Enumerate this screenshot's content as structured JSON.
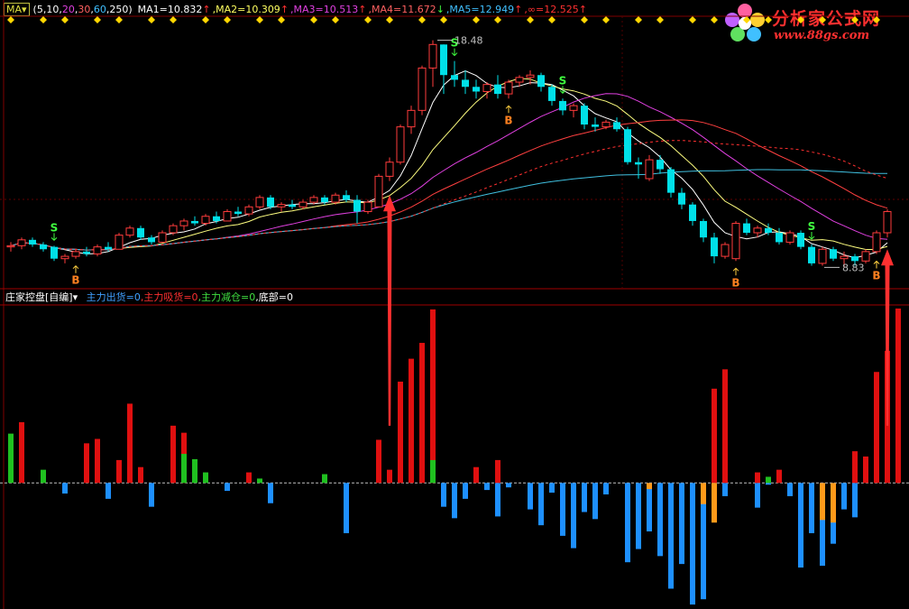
{
  "main_header": {
    "indicator_button": "MA",
    "params_open": "(",
    "params": [
      {
        "text": "5",
        "color": "#ffffff"
      },
      {
        "text": "10",
        "color": "#ffffff"
      },
      {
        "text": "20",
        "color": "#e040e0"
      },
      {
        "text": "30",
        "color": "#ff6060"
      },
      {
        "text": "60",
        "color": "#40c0ff"
      },
      {
        "text": "250",
        "color": "#ffffff"
      }
    ],
    "params_close": ")",
    "ma_values": [
      {
        "text": "MA1=10.832",
        "arrow": "↑",
        "color": "#ffffff",
        "arrow_color": "#ff3030"
      },
      {
        "text": "MA2=10.309",
        "arrow": "↑",
        "color": "#ffff60",
        "arrow_color": "#ff3030"
      },
      {
        "text": "MA3=10.513",
        "arrow": "↑",
        "color": "#e040e0",
        "arrow_color": "#ff3030"
      },
      {
        "text": "MA4=11.672",
        "arrow": "↓",
        "color": "#ff6060",
        "arrow_color": "#40ff40"
      },
      {
        "text": "MA5=12.949",
        "arrow": "↑",
        "color": "#40c0ff",
        "arrow_color": "#ff3030"
      },
      {
        "text": "∞=12.525",
        "arrow": "↑",
        "color": "#ff3030",
        "arrow_color": "#ff3030"
      }
    ]
  },
  "sub_header": {
    "title": "庄家控盘[自编]",
    "items": [
      {
        "text": "主力出货=0",
        "color": "#40a0ff"
      },
      {
        "text": "主力吸货=0",
        "color": "#ff3030"
      },
      {
        "text": "主力减仓=0",
        "color": "#40e040"
      },
      {
        "text": "底部=0",
        "color": "#ffffff"
      }
    ]
  },
  "logo": {
    "line1": "分析家公式网",
    "line2": "www.88gs.com"
  },
  "chart_data": [
    {
      "type": "candlestick",
      "title": "MA",
      "ylim": [
        8,
        19.5
      ],
      "annotations": {
        "high_label": "18.48",
        "low_label": "8.83"
      },
      "signals": [
        {
          "index": 4,
          "label": "S"
        },
        {
          "index": 6,
          "label": "B"
        },
        {
          "index": 41,
          "label": "S"
        },
        {
          "index": 46,
          "label": "B"
        },
        {
          "index": 51,
          "label": "S"
        },
        {
          "index": 67,
          "label": "B"
        },
        {
          "index": 74,
          "label": "S"
        },
        {
          "index": 80,
          "label": "B"
        }
      ],
      "candles": [
        [
          9.7,
          9.9,
          9.5,
          9.75
        ],
        [
          9.75,
          10.1,
          9.6,
          10.0
        ],
        [
          10.0,
          10.1,
          9.7,
          9.8
        ],
        [
          9.8,
          9.9,
          9.5,
          9.6
        ],
        [
          9.7,
          9.75,
          9.1,
          9.2
        ],
        [
          9.2,
          9.4,
          9.0,
          9.3
        ],
        [
          9.3,
          9.6,
          9.2,
          9.5
        ],
        [
          9.5,
          9.7,
          9.3,
          9.4
        ],
        [
          9.4,
          9.8,
          9.3,
          9.7
        ],
        [
          9.7,
          9.9,
          9.5,
          9.6
        ],
        [
          9.6,
          10.3,
          9.6,
          10.2
        ],
        [
          10.2,
          10.6,
          10.1,
          10.5
        ],
        [
          10.5,
          10.6,
          10.0,
          10.1
        ],
        [
          10.1,
          10.2,
          9.8,
          9.9
        ],
        [
          9.9,
          10.4,
          9.9,
          10.3
        ],
        [
          10.3,
          10.7,
          10.2,
          10.6
        ],
        [
          10.6,
          10.9,
          10.4,
          10.8
        ],
        [
          10.8,
          11.0,
          10.6,
          10.7
        ],
        [
          10.7,
          11.1,
          10.6,
          11.0
        ],
        [
          11.0,
          11.2,
          10.7,
          10.8
        ],
        [
          10.8,
          11.3,
          10.8,
          11.2
        ],
        [
          11.2,
          11.4,
          11.0,
          11.1
        ],
        [
          11.1,
          11.5,
          11.0,
          11.4
        ],
        [
          11.4,
          11.9,
          11.3,
          11.8
        ],
        [
          11.8,
          11.9,
          11.3,
          11.4
        ],
        [
          11.4,
          11.6,
          11.2,
          11.5
        ],
        [
          11.5,
          11.7,
          11.3,
          11.4
        ],
        [
          11.4,
          11.7,
          11.3,
          11.6
        ],
        [
          11.6,
          11.9,
          11.5,
          11.8
        ],
        [
          11.8,
          11.9,
          11.5,
          11.6
        ],
        [
          11.6,
          12.0,
          11.5,
          11.9
        ],
        [
          11.9,
          12.1,
          11.6,
          11.7
        ],
        [
          11.7,
          11.9,
          10.7,
          11.2
        ],
        [
          11.2,
          11.7,
          11.1,
          11.6
        ],
        [
          11.4,
          12.8,
          11.4,
          12.7
        ],
        [
          12.7,
          13.5,
          12.5,
          13.3
        ],
        [
          13.3,
          14.9,
          13.2,
          14.8
        ],
        [
          14.8,
          15.7,
          14.5,
          15.5
        ],
        [
          15.5,
          17.4,
          15.3,
          17.3
        ],
        [
          17.3,
          18.48,
          16.5,
          18.3
        ],
        [
          18.3,
          18.3,
          16.2,
          17.0
        ],
        [
          17.0,
          17.6,
          16.5,
          16.8
        ],
        [
          16.8,
          17.2,
          16.2,
          16.5
        ],
        [
          16.5,
          16.8,
          16.0,
          16.3
        ],
        [
          16.3,
          16.7,
          16.0,
          16.6
        ],
        [
          16.6,
          17.0,
          16.0,
          16.2
        ],
        [
          16.2,
          16.8,
          16.0,
          16.7
        ],
        [
          16.7,
          17.0,
          16.5,
          16.9
        ],
        [
          16.9,
          17.2,
          16.6,
          17.0
        ],
        [
          17.0,
          17.1,
          16.3,
          16.5
        ],
        [
          16.5,
          16.6,
          15.7,
          15.9
        ],
        [
          15.9,
          16.0,
          15.3,
          15.5
        ],
        [
          15.5,
          15.8,
          15.2,
          15.7
        ],
        [
          15.7,
          15.8,
          14.7,
          14.9
        ],
        [
          14.9,
          15.2,
          14.6,
          14.8
        ],
        [
          14.8,
          15.1,
          14.7,
          15.0
        ],
        [
          15.0,
          15.2,
          14.6,
          14.7
        ],
        [
          14.7,
          14.8,
          13.2,
          13.3
        ],
        [
          13.3,
          13.5,
          12.6,
          13.2
        ],
        [
          12.6,
          13.6,
          12.5,
          13.4
        ],
        [
          13.4,
          13.6,
          12.8,
          13.0
        ],
        [
          13.0,
          13.1,
          11.8,
          12.0
        ],
        [
          12.0,
          12.2,
          11.3,
          11.5
        ],
        [
          11.5,
          11.6,
          10.6,
          10.8
        ],
        [
          10.8,
          10.9,
          9.9,
          10.1
        ],
        [
          10.1,
          10.3,
          9.0,
          9.3
        ],
        [
          9.3,
          9.9,
          9.2,
          9.8
        ],
        [
          9.2,
          10.8,
          9.1,
          10.7
        ],
        [
          10.7,
          10.9,
          10.2,
          10.3
        ],
        [
          10.3,
          10.6,
          10.1,
          10.5
        ],
        [
          10.5,
          10.7,
          10.2,
          10.3
        ],
        [
          10.3,
          10.5,
          9.8,
          9.9
        ],
        [
          9.9,
          10.4,
          9.8,
          10.3
        ],
        [
          10.3,
          10.4,
          9.6,
          9.7
        ],
        [
          9.7,
          9.8,
          8.9,
          9.0
        ],
        [
          9.0,
          9.7,
          8.9,
          9.6
        ],
        [
          9.6,
          9.7,
          9.1,
          9.2
        ],
        [
          9.2,
          9.5,
          8.83,
          9.3
        ],
        [
          9.3,
          9.4,
          8.9,
          9.1
        ],
        [
          9.1,
          9.6,
          9.0,
          9.5
        ],
        [
          9.5,
          10.4,
          9.4,
          10.3
        ],
        [
          10.3,
          11.3,
          10.1,
          11.2
        ]
      ]
    },
    {
      "type": "bar",
      "title": "庄家控盘[自编]",
      "ylim": [
        -14,
        20
      ],
      "series": [
        {
          "name": "主力出货",
          "values": [
            0,
            0,
            0,
            0,
            0,
            -1.2,
            0,
            0,
            0,
            -1.8,
            0,
            0,
            0,
            -2.7,
            0,
            0,
            0,
            0,
            0,
            0,
            -0.9,
            0,
            0,
            0,
            -2.3,
            0,
            0,
            0,
            0,
            0,
            0,
            -5.7,
            0,
            0,
            0,
            0,
            0,
            0,
            0,
            0,
            -2.7,
            -4.0,
            -1.8,
            0,
            -0.8,
            -3.8,
            -0.5,
            0,
            -3.0,
            -4.8,
            -1.1,
            -6.0,
            -7.4,
            -3.3,
            -4.1,
            -1.3,
            0,
            -9.0,
            -7.5,
            -5.5,
            -8.3,
            -12.0,
            -9.2,
            -13.8,
            -13.2,
            -3.6,
            -1.5,
            0,
            0,
            -2.8,
            -0.2,
            0,
            -1.5,
            -9.6,
            -5.7,
            -9.4,
            -6.9,
            -3.0,
            -3.9,
            0,
            0,
            0,
            0
          ]
        },
        {
          "name": "主力吸货",
          "values": [
            0,
            6.9,
            0,
            0,
            0,
            0,
            0,
            4.5,
            5.0,
            0,
            2.6,
            9.0,
            1.8,
            0,
            0,
            6.5,
            5.7,
            0,
            0,
            0,
            0,
            0,
            1.2,
            0,
            0,
            0,
            0,
            0,
            0,
            0,
            0,
            0,
            0,
            0,
            4.9,
            1.5,
            11.5,
            14.1,
            15.9,
            19.7,
            0,
            0,
            0,
            1.8,
            0,
            2.6,
            0,
            0,
            0,
            0,
            0,
            0,
            0,
            0,
            0,
            0,
            0,
            0,
            0,
            0,
            0,
            0,
            0,
            0,
            0,
            10.7,
            12.9,
            0,
            0,
            1.2,
            0,
            1.5,
            0,
            0,
            0,
            0,
            0,
            0,
            3.6,
            3.0,
            12.6,
            15.0,
            19.8
          ]
        },
        {
          "name": "主力减仓",
          "values": [
            5.6,
            0,
            0,
            1.5,
            0,
            0,
            0,
            0,
            0,
            0,
            0,
            0,
            0,
            0,
            0,
            0,
            3.3,
            2.7,
            1.2,
            0,
            0,
            0,
            0,
            0.5,
            0,
            0,
            0,
            0,
            0,
            1.0,
            0,
            0,
            0,
            0,
            0,
            0,
            0,
            0,
            0,
            2.6,
            0,
            0,
            0,
            0,
            0,
            0,
            0,
            0,
            0,
            0,
            0,
            0,
            0,
            0,
            0,
            0,
            0,
            0,
            0,
            0,
            0,
            0,
            0,
            0,
            0,
            0,
            0,
            0,
            0,
            0,
            0.7,
            0,
            0,
            0,
            0,
            0,
            0,
            0,
            0,
            0,
            0,
            0,
            0
          ]
        },
        {
          "name": "底部",
          "values": [
            0,
            0,
            0,
            0,
            0,
            0,
            0,
            0,
            0,
            0,
            0,
            0,
            0,
            0,
            0,
            0,
            0,
            0,
            0,
            0,
            0,
            0,
            0,
            0,
            0,
            0,
            0,
            0,
            0,
            0,
            0,
            0,
            0,
            0,
            0,
            0,
            0,
            0,
            0,
            0,
            0,
            0,
            0,
            0,
            0,
            0,
            0,
            0,
            0,
            0,
            0,
            0,
            0,
            0,
            0,
            0,
            0,
            0,
            0,
            -0.7,
            0,
            0,
            0,
            0,
            -2.4,
            -4.5,
            0,
            0,
            0,
            0,
            0,
            0,
            0,
            0,
            0,
            -4.2,
            -4.5,
            0,
            0,
            0,
            0,
            0
          ]
        }
      ]
    }
  ]
}
